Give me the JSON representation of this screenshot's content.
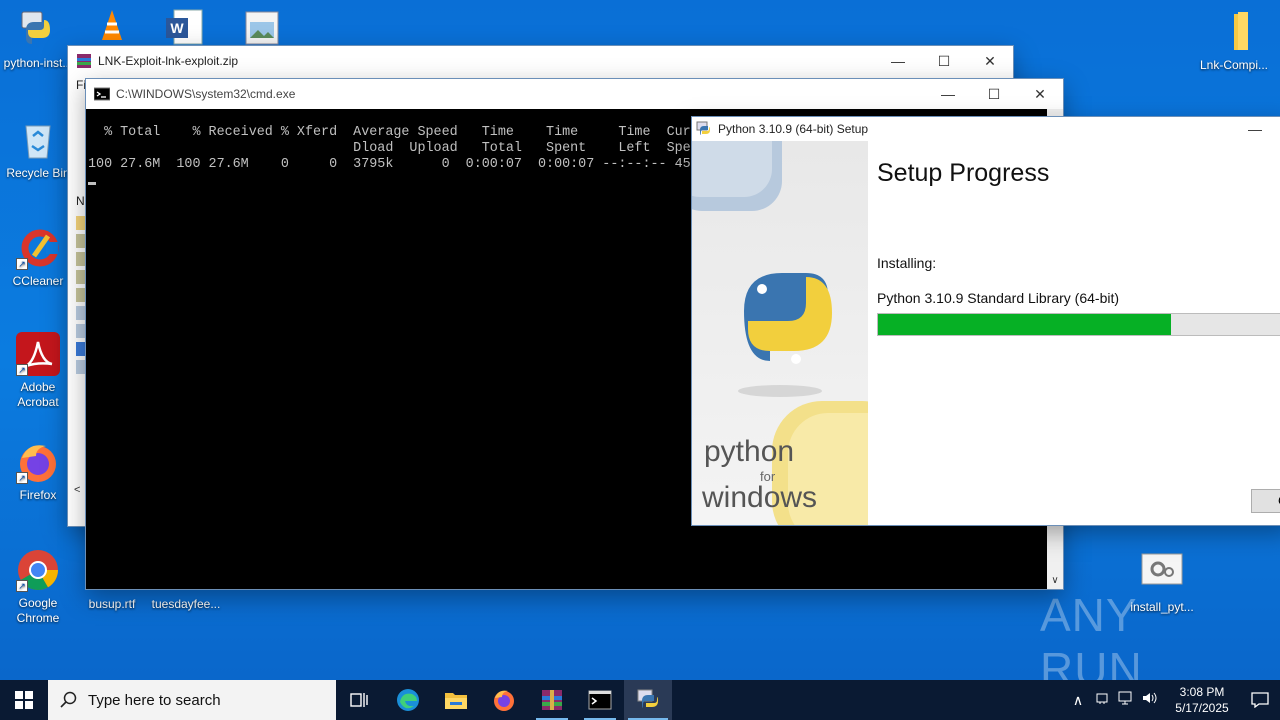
{
  "desktop": {
    "icons_left": [
      {
        "label": "python-inst..."
      },
      {
        "label": "Recycle Bin"
      },
      {
        "label": "CCleaner"
      },
      {
        "label": "Adobe Acrobat"
      },
      {
        "label": "Firefox"
      },
      {
        "label": "Google Chrome"
      }
    ],
    "busup": "busup.rtf",
    "tuesday": "tuesdayfee...",
    "lnk_compi": "Lnk-Compi...",
    "install_pyt": "install_pyt...",
    "watermark": "ANY RUN"
  },
  "winrar": {
    "title": "LNK-Exploit-lnk-exploit.zip",
    "menu_fragment": "Fi",
    "col_fragment": "N"
  },
  "cmd": {
    "title": "C:\\WINDOWS\\system32\\cmd.exe",
    "lines": [
      "  % Total    % Received % Xferd  Average Speed   Time    Time     Time  Current",
      "                                 Dload  Upload   Total   Spent    Left  Speed",
      "100 27.6M  100 27.6M    0     0  3795k      0  0:00:07  0:00:07 --:--:-- 4573k"
    ]
  },
  "setup": {
    "title": "Python 3.10.9 (64-bit) Setup",
    "heading": "Setup Progress",
    "installing_label": "Installing:",
    "current_item": "Python 3.10.9 Standard Library (64-bit)",
    "progress_fraction": 0.7,
    "python_word": "python",
    "for_word": "for",
    "windows_word": "windows",
    "button_fragment": "C"
  },
  "taskbar": {
    "search_placeholder": "Type here to search",
    "time": "3:08 PM",
    "date": "5/17/2025"
  },
  "colors": {
    "progress_fill": "#06b025",
    "desktop": "#0a6fd6",
    "taskbar": "#0a1a33"
  }
}
